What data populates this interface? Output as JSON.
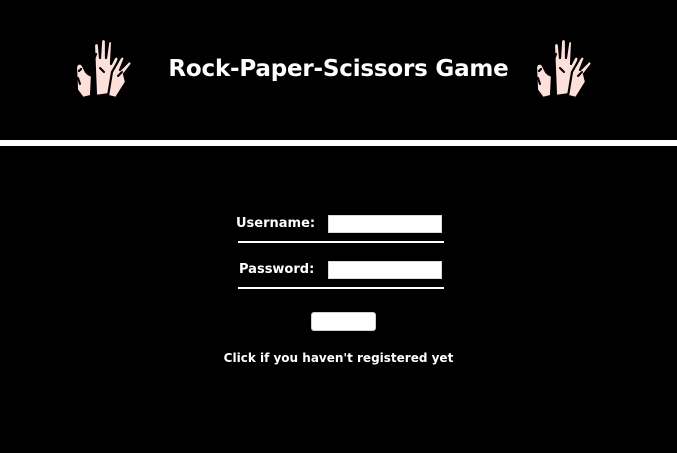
{
  "header": {
    "title": "Rock-Paper-Scissors Game",
    "left_icon": "rock-paper-scissors-hands-icon",
    "right_icon": "rock-paper-scissors-hands-icon"
  },
  "colors": {
    "background": "#000000",
    "text": "#ffffff",
    "hand_skin": "#fde0da",
    "hand_outline": "#000000"
  },
  "login_form": {
    "username_label": "Username:",
    "username_value": "",
    "password_label": "Password:",
    "password_value": "",
    "submit_label": "",
    "register_link": "Click if you haven't registered yet"
  }
}
